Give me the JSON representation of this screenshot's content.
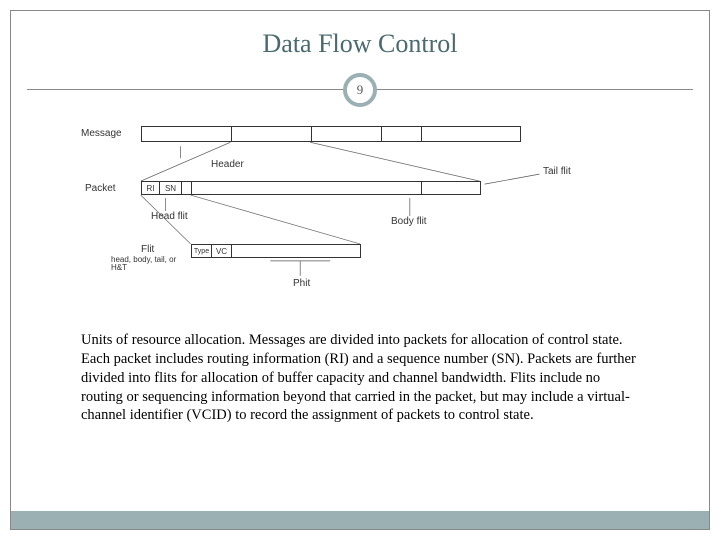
{
  "title": "Data Flow Control",
  "page_number": "9",
  "diagram": {
    "rows": {
      "message": {
        "label": "Message"
      },
      "packet": {
        "label": "Packet",
        "ri": "RI",
        "sn": "SN"
      },
      "flit": {
        "label": "Flit",
        "sublabel": "head, body, tail, or H&T",
        "type": "Type",
        "vc": "VC"
      }
    },
    "annotations": {
      "header": "Header",
      "head_flit": "Head flit",
      "body_flit": "Body flit",
      "tail_flit": "Tail flit",
      "phit": "Phit"
    }
  },
  "body_text": "Units of resource allocation. Messages are divided into packets for allocation of control state. Each packet includes routing information (RI) and a sequence number (SN). Packets are further divided into flits for allocation of buffer capacity and channel bandwidth. Flits include no routing or sequencing information beyond that carried in the packet, but may include a virtual-channel identifier (VCID) to record the assignment of packets to control state."
}
